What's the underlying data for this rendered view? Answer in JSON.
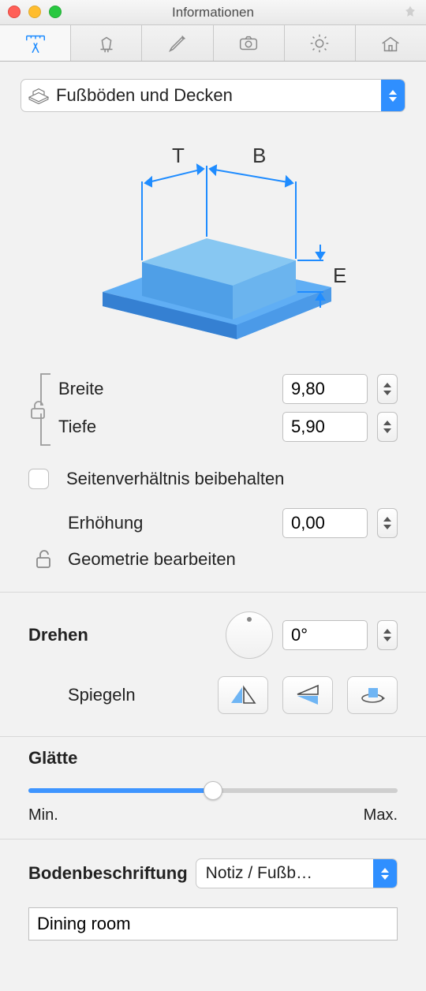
{
  "window": {
    "title": "Informationen"
  },
  "category": {
    "icon": "floor-cube-icon",
    "label": "Fußböden und Decken"
  },
  "diagram": {
    "labels": {
      "t": "T",
      "b": "B",
      "e": "E"
    }
  },
  "dimensions": {
    "breite": {
      "label": "Breite",
      "value": "9,80"
    },
    "tiefe": {
      "label": "Tiefe",
      "value": "5,90"
    },
    "keep_ratio_label": "Seitenverhältnis beibehalten",
    "erhoehung": {
      "label": "Erhöhung",
      "value": "0,00"
    },
    "edit_geometry_label": "Geometrie bearbeiten"
  },
  "rotate": {
    "title": "Drehen",
    "angle": "0°",
    "mirror_label": "Spiegeln"
  },
  "smooth": {
    "title": "Glätte",
    "min_label": "Min.",
    "max_label": "Max.",
    "value_percent": 50
  },
  "floor_label": {
    "title": "Bodenbeschriftung",
    "select_label": "Notiz / Fußb…",
    "value": "Dining room"
  }
}
